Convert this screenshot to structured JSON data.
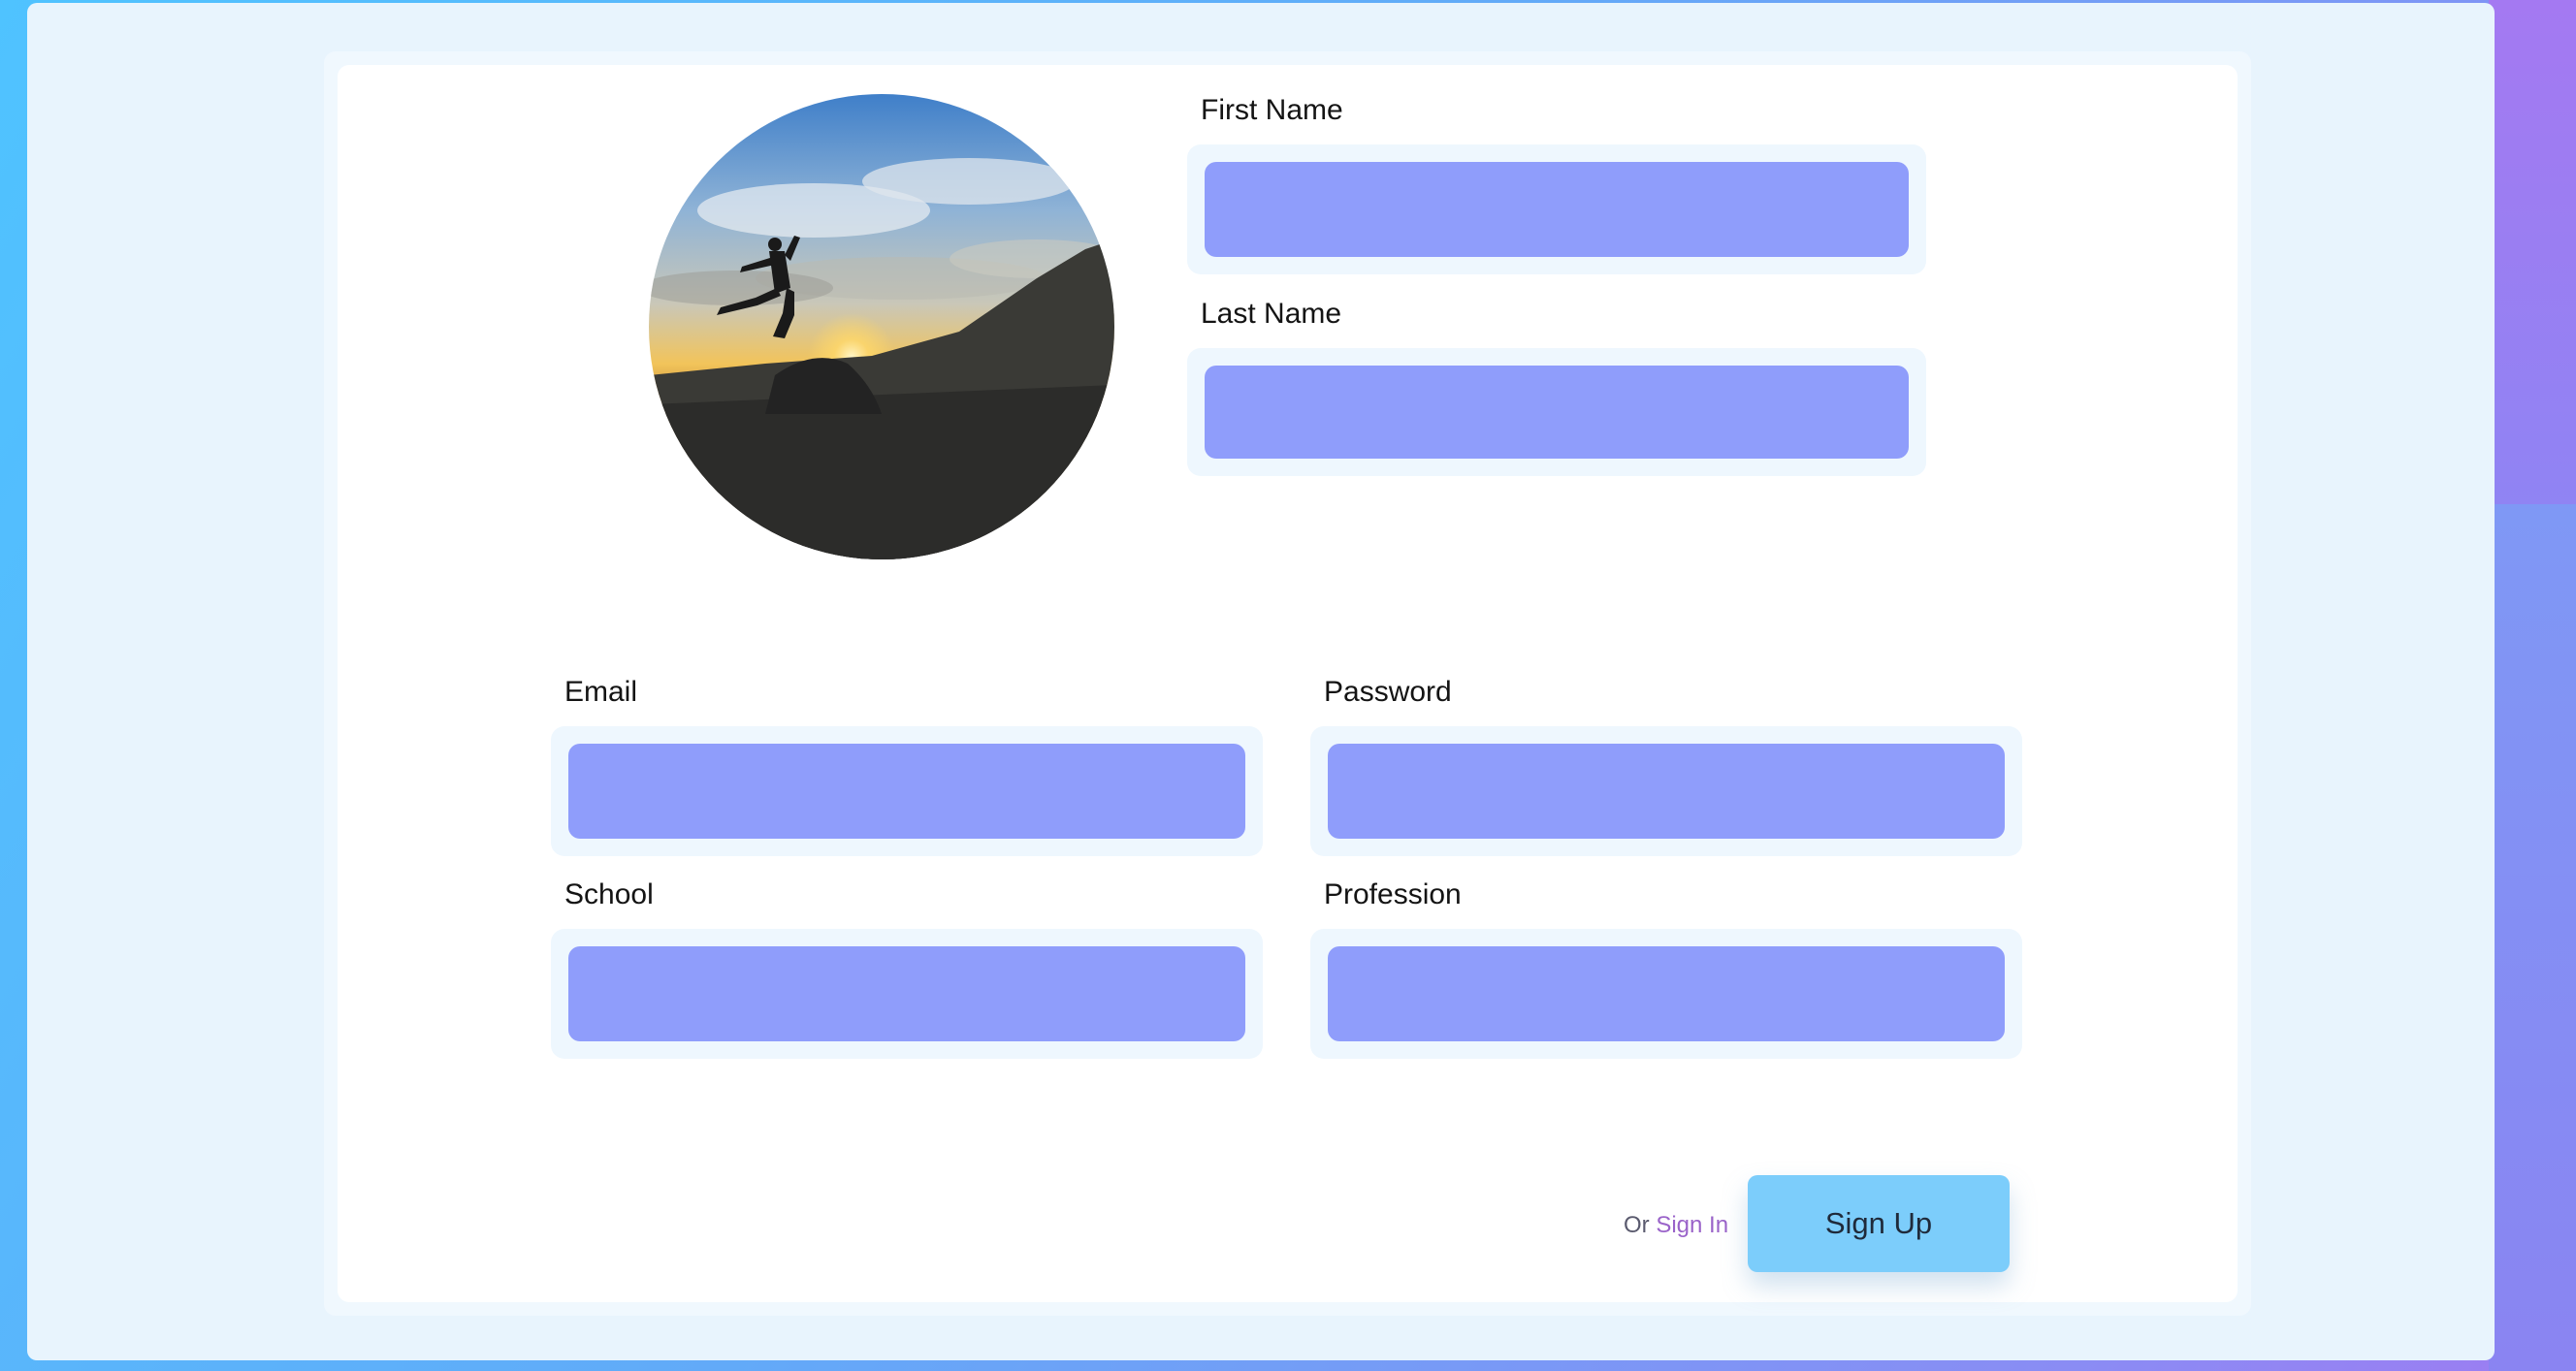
{
  "form": {
    "first_name": {
      "label": "First Name",
      "value": ""
    },
    "last_name": {
      "label": "Last Name",
      "value": ""
    },
    "email": {
      "label": "Email",
      "value": ""
    },
    "password": {
      "label": "Password",
      "value": ""
    },
    "school": {
      "label": "School",
      "value": ""
    },
    "profession": {
      "label": "Profession",
      "value": ""
    }
  },
  "footer": {
    "or_text": "Or",
    "sign_in_label": "Sign In",
    "sign_up_label": "Sign Up"
  },
  "colors": {
    "input_fill": "#8f9dfb",
    "field_frame": "#eef7fe",
    "sign_up_button": "#7ccdfb",
    "sign_in_link": "#9a63c9"
  },
  "avatar": {
    "icon": "profile-photo-silhouette-sunset"
  }
}
